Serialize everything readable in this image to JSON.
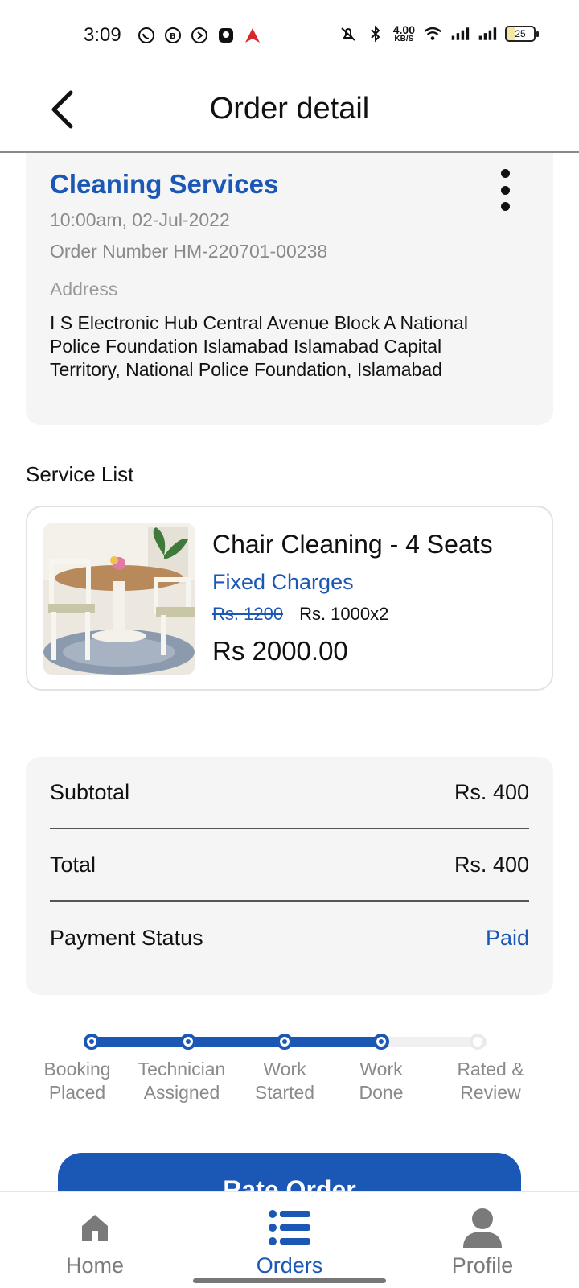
{
  "status_bar": {
    "time": "3:09",
    "left_icons": [
      "whatsapp-icon",
      "b-app-icon",
      "play-icon",
      "square-app-icon",
      "a-app-icon"
    ],
    "net_speed": "4.00",
    "net_unit": "KB/S",
    "battery": "25"
  },
  "header": {
    "title": "Order detail"
  },
  "order": {
    "service": "Cleaning Services",
    "datetime": "10:00am, 02-Jul-2022",
    "order_number": "Order Number HM-220701-00238",
    "address_label": "Address",
    "address": "I S Electronic Hub Central Avenue Block A National Police Foundation Islamabad Islamabad Capital Territory, National Police Foundation, Islamabad"
  },
  "service_list": {
    "label": "Service List",
    "items": [
      {
        "name": "Chair Cleaning - 4 Seats",
        "charge_type": "Fixed Charges",
        "old_price": "Rs. 1200",
        "new_price": "Rs. 1000",
        "qty": "x2",
        "total": "Rs 2000.00"
      }
    ]
  },
  "summary": {
    "subtotal_label": "Subtotal",
    "subtotal": "Rs. 400",
    "total_label": "Total",
    "total": "Rs. 400",
    "payment_label": "Payment Status",
    "payment_status": "Paid"
  },
  "progress": {
    "completed_steps": 4,
    "steps": [
      {
        "label": "Booking\nPlaced"
      },
      {
        "label": "Technician\nAssigned"
      },
      {
        "label": "Work\nStarted"
      },
      {
        "label": "Work\nDone"
      },
      {
        "label": "Rated &\nReview"
      }
    ]
  },
  "rate_button": "Rate Order",
  "colors": {
    "accent": "#1b57b4",
    "card_bg": "#f5f5f5",
    "muted_text": "#8a8a8a"
  },
  "bottom_nav": {
    "items": [
      {
        "label": "Home",
        "icon": "home-icon"
      },
      {
        "label": "Orders",
        "icon": "list-icon"
      },
      {
        "label": "Profile",
        "icon": "person-icon"
      }
    ],
    "active": "Orders"
  }
}
